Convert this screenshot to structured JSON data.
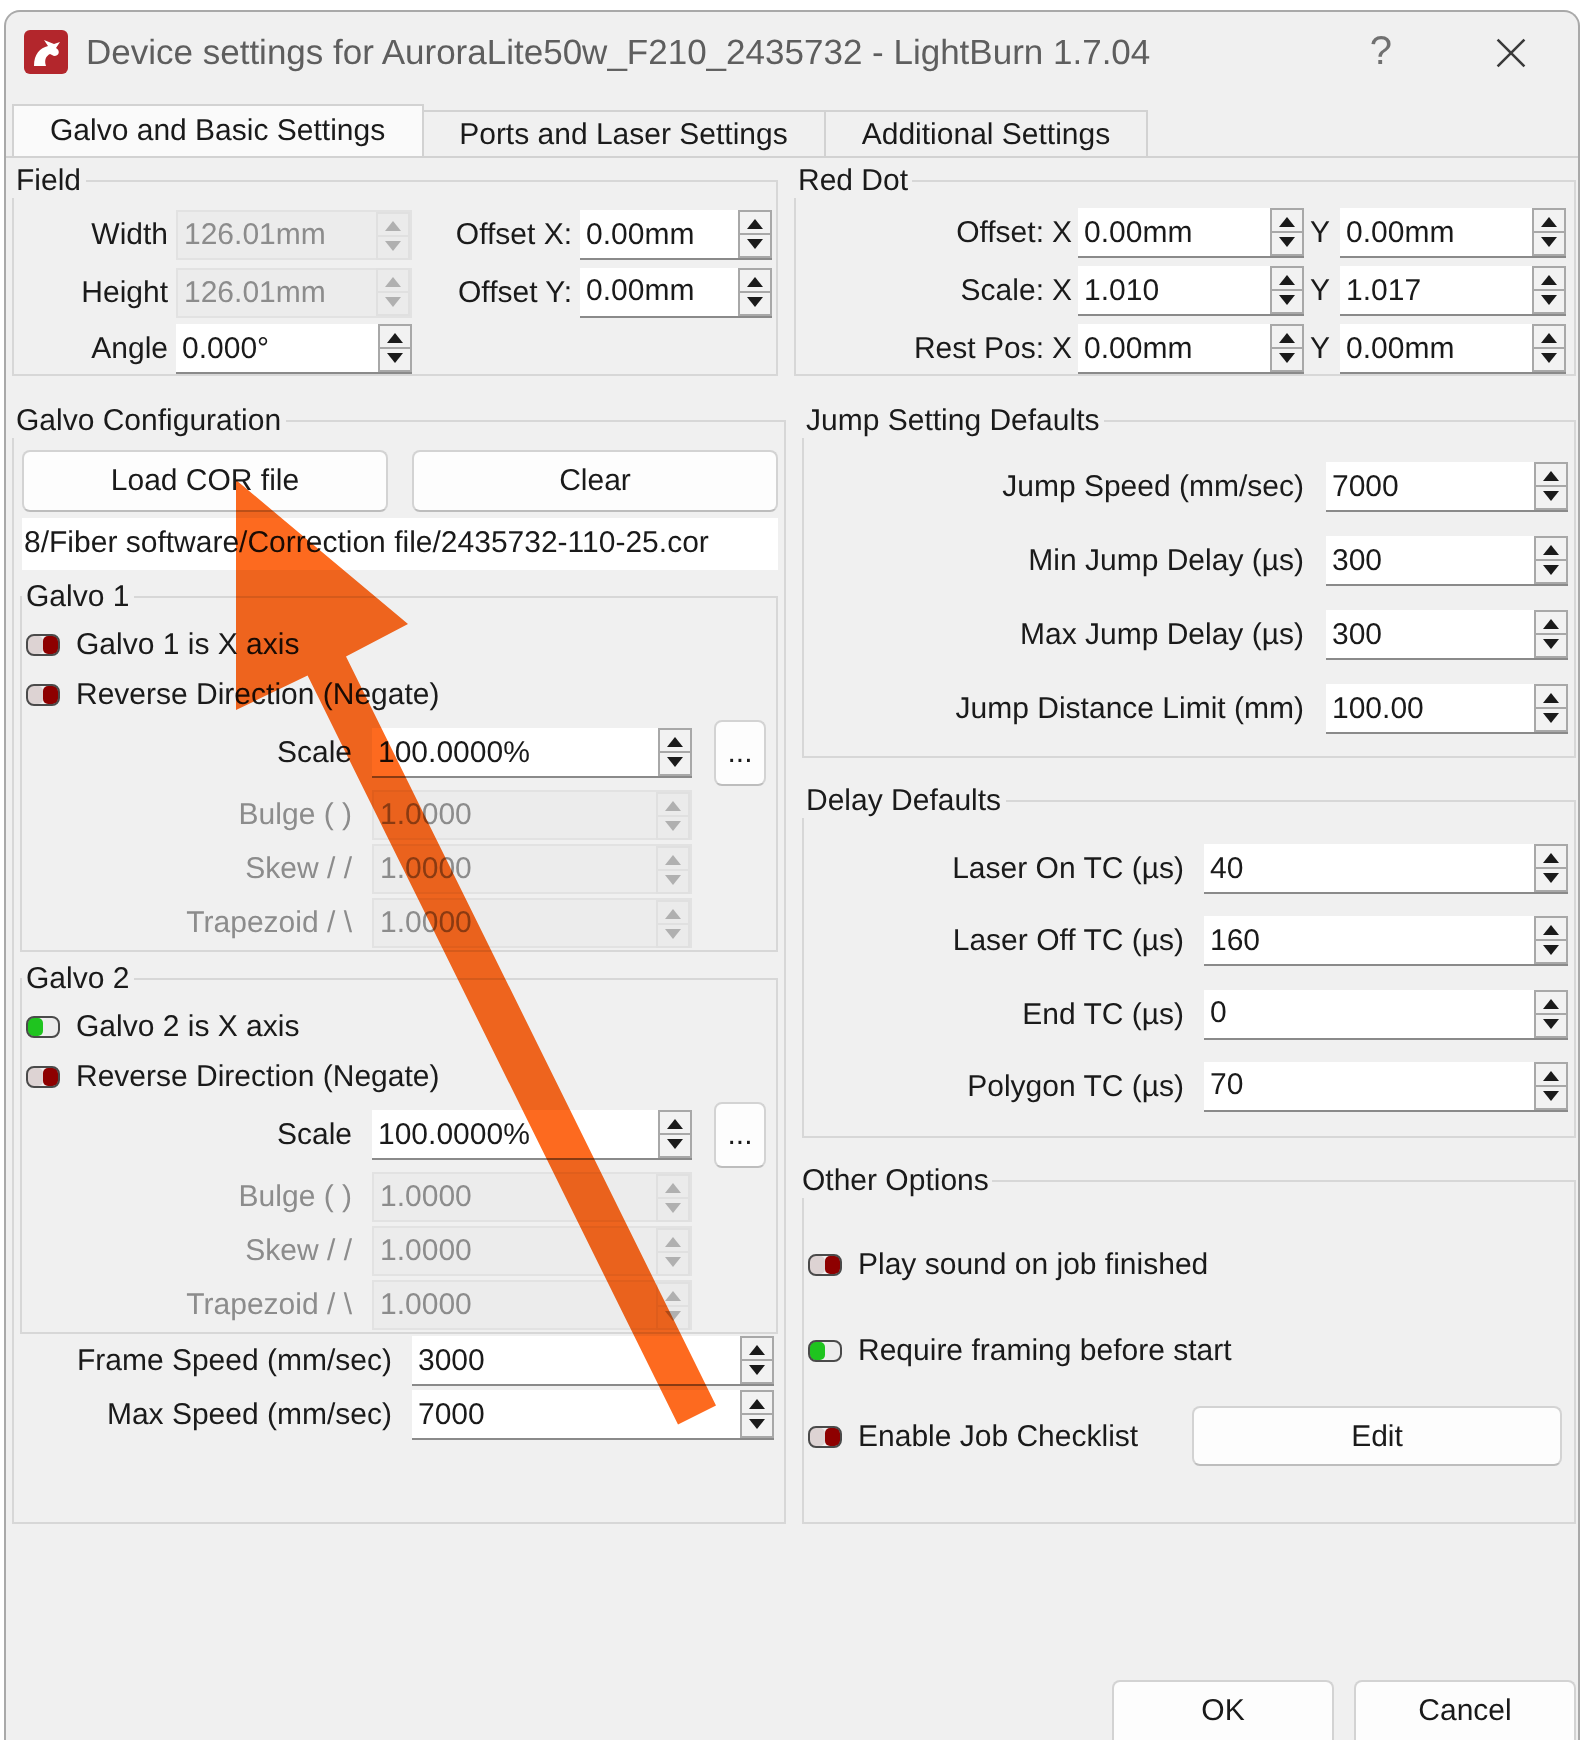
{
  "window": {
    "title": "Device settings for AuroraLite50w_F210_2435732 - LightBurn 1.7.04",
    "help": "?"
  },
  "tabs": [
    {
      "label": "Galvo and Basic Settings",
      "selected": true
    },
    {
      "label": "Ports and Laser Settings",
      "selected": false
    },
    {
      "label": "Additional Settings",
      "selected": false
    }
  ],
  "field": {
    "title": "Field",
    "columns": [
      [
        {
          "label": "Width",
          "value": "126.01mm",
          "disabled": true
        },
        {
          "label": "Height",
          "value": "126.01mm",
          "disabled": true
        },
        {
          "label": "Angle",
          "value": "0.000°",
          "disabled": false
        }
      ],
      [
        {
          "label": "Offset X:",
          "value": "0.00mm",
          "disabled": false
        },
        {
          "label": "Offset Y:",
          "value": "0.00mm",
          "disabled": false
        }
      ]
    ]
  },
  "red_dot": {
    "title": "Red Dot",
    "rows": [
      {
        "label": "Offset:",
        "fields": [
          {
            "axis": "X",
            "value": "0.00mm"
          },
          {
            "axis": "Y",
            "value": "0.00mm"
          }
        ]
      },
      {
        "label": "Scale:",
        "fields": [
          {
            "axis": "X",
            "value": "1.010"
          },
          {
            "axis": "Y",
            "value": "1.017"
          }
        ]
      },
      {
        "label": "Rest Pos:",
        "fields": [
          {
            "axis": "X",
            "value": "0.00mm"
          },
          {
            "axis": "Y",
            "value": "0.00mm"
          }
        ]
      }
    ]
  },
  "galvo_configuration": {
    "title": "Galvo Configuration",
    "buttons": [
      "Load COR file",
      "Clear"
    ],
    "file_path": "8/Fiber software/Correction file/2435732-110-25.cor",
    "galvos": [
      {
        "title": "Galvo 1",
        "toggles": [
          {
            "label": "Galvo 1 is X axis",
            "on": false
          },
          {
            "label": "Reverse Direction (Negate)",
            "on": false
          }
        ],
        "spinboxes": [
          {
            "label": "Scale",
            "value": "100.0000%",
            "disabled": false,
            "button": "..."
          },
          {
            "label": "Bulge ( )",
            "value": "1.0000",
            "disabled": true
          },
          {
            "label": "Skew / /",
            "value": "1.0000",
            "disabled": true
          },
          {
            "label": "Trapezoid / \\",
            "value": "1.0000",
            "disabled": true
          }
        ]
      },
      {
        "title": "Galvo 2",
        "toggles": [
          {
            "label": "Galvo 2 is X axis",
            "on": true
          },
          {
            "label": "Reverse Direction (Negate)",
            "on": false
          }
        ],
        "spinboxes": [
          {
            "label": "Scale",
            "value": "100.0000%",
            "disabled": false,
            "button": "..."
          },
          {
            "label": "Bulge ( )",
            "value": "1.0000",
            "disabled": true
          },
          {
            "label": "Skew / /",
            "value": "1.0000",
            "disabled": true
          },
          {
            "label": "Trapezoid / \\",
            "value": "1.0000",
            "disabled": true
          }
        ]
      }
    ],
    "speeds": [
      {
        "label": "Frame Speed (mm/sec)",
        "value": "3000"
      },
      {
        "label": "Max Speed (mm/sec)",
        "value": "7000"
      }
    ]
  },
  "jump_setting_defaults": {
    "title": "Jump Setting Defaults",
    "spinboxes": [
      {
        "label": "Jump Speed (mm/sec)",
        "value": "7000"
      },
      {
        "label": "Min Jump Delay (µs)",
        "value": "300"
      },
      {
        "label": "Max Jump Delay (µs)",
        "value": "300"
      },
      {
        "label": "Jump Distance Limit (mm)",
        "value": "100.00"
      }
    ]
  },
  "delay_defaults": {
    "title": "Delay Defaults",
    "spinboxes": [
      {
        "label": "Laser On TC (µs)",
        "value": "40"
      },
      {
        "label": "Laser Off TC (µs)",
        "value": "160"
      },
      {
        "label": "End TC (µs)",
        "value": "0"
      },
      {
        "label": "Polygon TC (µs)",
        "value": "70"
      }
    ]
  },
  "other_options": {
    "title": "Other Options",
    "toggles": [
      {
        "label": "Play sound on job finished",
        "on": false
      },
      {
        "label": "Require framing before start",
        "on": true
      },
      {
        "label": "Enable Job Checklist",
        "on": false,
        "button": "Edit"
      }
    ]
  },
  "buttons": [
    "OK",
    "Cancel"
  ],
  "annotations": [
    {
      "kind": "arrow"
    }
  ]
}
